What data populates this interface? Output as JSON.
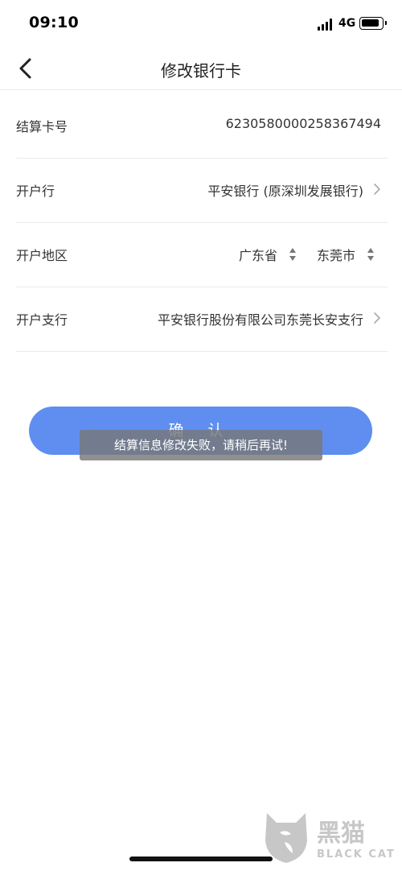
{
  "status_bar": {
    "time": "09:10",
    "network": "4G"
  },
  "nav": {
    "title": "修改银行卡"
  },
  "form": {
    "rows": [
      {
        "label": "结算卡号",
        "value": "6230580000258367494"
      },
      {
        "label": "开户行",
        "value": "平安银行 (原深圳发展银行)"
      },
      {
        "label": "开户地区",
        "province": "广东省",
        "city": "东莞市"
      },
      {
        "label": "开户支行",
        "value": "平安银行股份有限公司东莞长安支行"
      }
    ]
  },
  "confirm_button": {
    "label": "确 认",
    "color": "#5f8ef0"
  },
  "toast": {
    "message": "结算信息修改失败，请稍后再试!"
  },
  "watermark": {
    "cn": "黑猫",
    "en": "BLACK CAT"
  }
}
